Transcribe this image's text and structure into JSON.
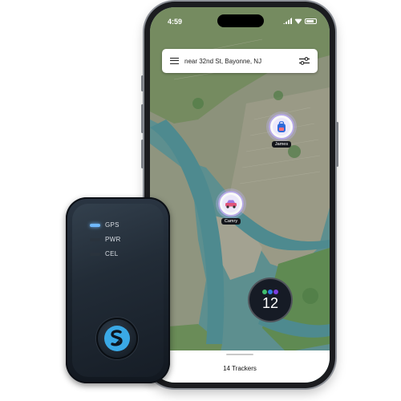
{
  "status_bar": {
    "time": "4:59"
  },
  "search": {
    "location_text": "near 32nd St, Bayonne, NJ"
  },
  "markers": [
    {
      "label": "James",
      "icon": "backpack-icon"
    },
    {
      "label": "Camry",
      "icon": "car-icon"
    }
  ],
  "cluster": {
    "count": "12",
    "dot_colors": [
      "#3fbf6e",
      "#2f7de0",
      "#7b3fe0"
    ]
  },
  "bottom_sheet": {
    "trackers_label": "14 Trackers"
  },
  "device": {
    "indicators": [
      {
        "label": "GPS",
        "led_color": "#6fb8ff",
        "lit": true
      },
      {
        "label": "PWR",
        "led_color": "#2a333d",
        "lit": false
      },
      {
        "label": "CEL",
        "led_color": "#2a333d",
        "lit": false
      }
    ],
    "button_icon": "s-logo-icon",
    "accent_color": "#3aa9e6"
  },
  "colors": {
    "marker_ring": "#b6a9e6",
    "water": "#4f8f93",
    "land": "#7a8e68"
  }
}
